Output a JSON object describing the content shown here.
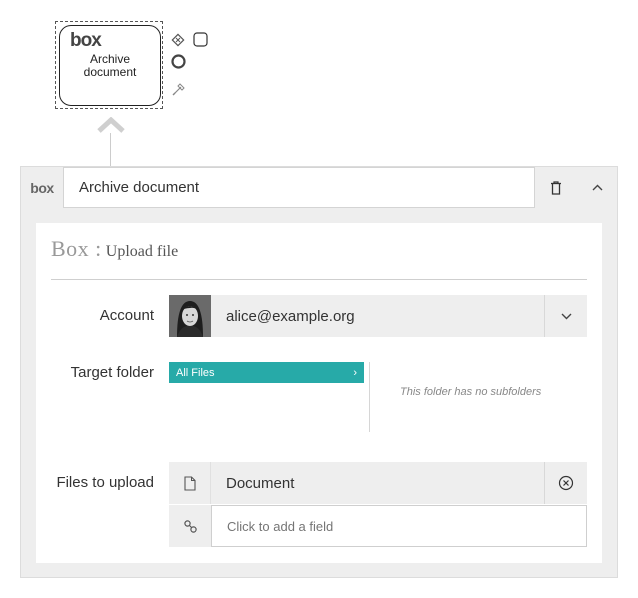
{
  "node": {
    "logo": "box",
    "label_line1": "Archive",
    "label_line2": "document"
  },
  "header": {
    "logo": "box",
    "name_value": "Archive document",
    "delete_icon": "trash-icon",
    "collapse_icon": "chevron-up-icon"
  },
  "form": {
    "title_service": "Box :",
    "title_action": "Upload file",
    "account": {
      "label": "Account",
      "value": "alice@example.org"
    },
    "target_folder": {
      "label": "Target folder",
      "selected": "All Files",
      "empty_message": "This folder has no subfolders"
    },
    "files_to_upload": {
      "label": "Files to upload",
      "item": "Document",
      "add_placeholder": "Click to add a field"
    }
  },
  "colors": {
    "accent": "#27aaa8",
    "panel_bg": "#eeeeee"
  }
}
